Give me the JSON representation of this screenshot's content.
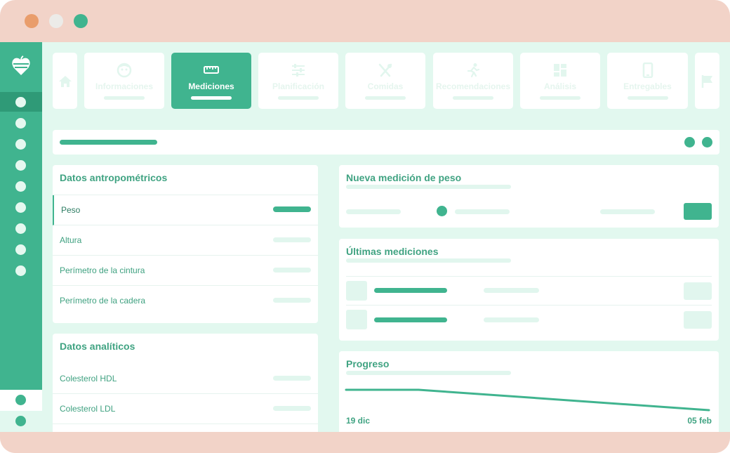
{
  "window": {
    "controls": [
      "close",
      "minimize",
      "maximize"
    ]
  },
  "colors": {
    "accent": "#40b48f",
    "accent_dark": "#2f9a77",
    "background": "#e2f8ef",
    "frame": "#f2d3c8",
    "text": "#40a382"
  },
  "sidebar": {
    "logo": "heart-apple-logo",
    "items": [
      "nav-item-1",
      "nav-item-2",
      "nav-item-3",
      "nav-item-4",
      "nav-item-5",
      "nav-item-6",
      "nav-item-7",
      "nav-item-8",
      "nav-item-9"
    ],
    "active_index": 0
  },
  "tabs": [
    {
      "label": "",
      "icon": "home-icon"
    },
    {
      "label": "Informaciones",
      "icon": "face-icon"
    },
    {
      "label": "Mediciones",
      "icon": "ruler-icon",
      "active": true
    },
    {
      "label": "Planificación",
      "icon": "sliders-icon"
    },
    {
      "label": "Comidas",
      "icon": "utensils-icon"
    },
    {
      "label": "Recomendaciones",
      "icon": "running-icon"
    },
    {
      "label": "Análisis",
      "icon": "dashboard-icon"
    },
    {
      "label": "Entregables",
      "icon": "phone-icon"
    },
    {
      "label": "",
      "icon": "flag-icon"
    }
  ],
  "anthropometric": {
    "title": "Datos antropométricos",
    "rows": [
      "Peso",
      "Altura",
      "Perímetro de la cintura",
      "Perímetro de la cadera"
    ],
    "active_row": "Peso"
  },
  "analytic": {
    "title": "Datos analíticos",
    "rows": [
      "Colesterol HDL",
      "Colesterol LDL"
    ]
  },
  "new_measurement": {
    "title": "Nueva medición de peso"
  },
  "last_measurements": {
    "title": "Últimas mediciones"
  },
  "progress": {
    "title": "Progreso"
  },
  "chart_data": {
    "type": "line",
    "title": "Progreso",
    "x": [
      "19 dic",
      "05 feb"
    ],
    "series": [
      {
        "values": [
          1.0,
          1.0,
          0.0
        ]
      }
    ],
    "x_positions": [
      0.0,
      0.2,
      1.0
    ],
    "xlabel": "",
    "ylabel": "",
    "grid": false
  }
}
